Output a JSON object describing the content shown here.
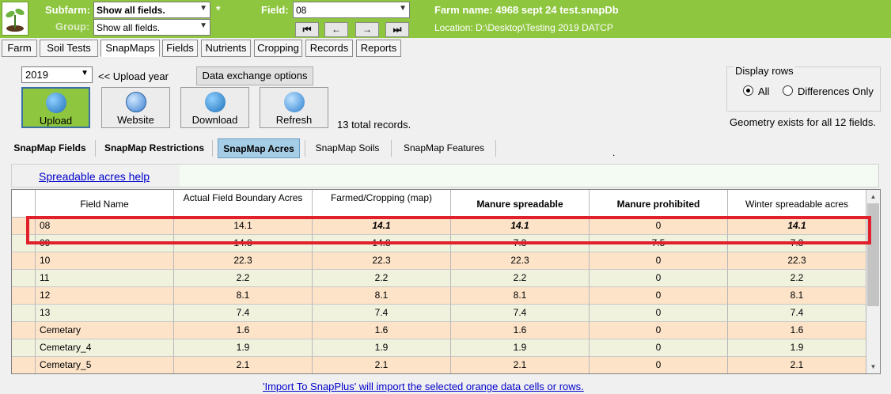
{
  "header": {
    "subfarm_label": "Subfarm:",
    "subfarm_value": "Show all fields.",
    "group_label": "Group:",
    "group_value": "Show all fields.",
    "asterisk": "*",
    "field_label": "Field:",
    "field_value": "08",
    "nav_first": "⏮",
    "nav_prev": "←",
    "nav_next": "→",
    "nav_last": "⏭",
    "farm_name": "Farm name: 4968 sept 24 test.snapDb",
    "location": "Location: D:\\Desktop\\Testing 2019 DATCP"
  },
  "main_tabs": [
    "Farm",
    "Soil Tests",
    "SnapMaps",
    "Fields",
    "Nutrients",
    "Cropping",
    "Records",
    "Reports"
  ],
  "controls": {
    "year": "2019",
    "upload_year_label": "<< Upload year",
    "data_exchange_label": "Data exchange options",
    "upload_label": "Upload",
    "website_label": "Website",
    "download_label": "Download",
    "refresh_label": "Refresh",
    "total_records": "13 total records.",
    "display_rows_label": "Display rows",
    "radio_all": "All",
    "radio_diff": "Differences Only",
    "geometry_msg": "Geometry exists for all 12 fields."
  },
  "sub_tabs": [
    "SnapMap Fields",
    "SnapMap Restrictions",
    "SnapMap Acres",
    "SnapMap Soils",
    "SnapMap Features"
  ],
  "dot": ".",
  "help_link": "Spreadable acres help",
  "table": {
    "headers": [
      "Field Name",
      "Actual Field Boundary Acres",
      "Farmed/Cropping (map)",
      "Manure spreadable",
      "Manure prohibited",
      "Winter spreadable acres"
    ],
    "rows": [
      {
        "name": "08",
        "actual": "14.1",
        "farmed": "14.1",
        "spread": "14.1",
        "prohib": "0",
        "winter": "14.1",
        "style": "orange"
      },
      {
        "name": "09",
        "actual": "14.8",
        "farmed": "14.8",
        "spread": "7.3",
        "prohib": "7.5",
        "winter": "7.3",
        "style": "green"
      },
      {
        "name": "10",
        "actual": "22.3",
        "farmed": "22.3",
        "spread": "22.3",
        "prohib": "0",
        "winter": "22.3",
        "style": "orange"
      },
      {
        "name": "11",
        "actual": "2.2",
        "farmed": "2.2",
        "spread": "2.2",
        "prohib": "0",
        "winter": "2.2",
        "style": "green"
      },
      {
        "name": "12",
        "actual": "8.1",
        "farmed": "8.1",
        "spread": "8.1",
        "prohib": "0",
        "winter": "8.1",
        "style": "orange"
      },
      {
        "name": "13",
        "actual": "7.4",
        "farmed": "7.4",
        "spread": "7.4",
        "prohib": "0",
        "winter": "7.4",
        "style": "green"
      },
      {
        "name": "Cemetary",
        "actual": "1.6",
        "farmed": "1.6",
        "spread": "1.6",
        "prohib": "0",
        "winter": "1.6",
        "style": "orange"
      },
      {
        "name": "Cemetary_4",
        "actual": "1.9",
        "farmed": "1.9",
        "spread": "1.9",
        "prohib": "0",
        "winter": "1.9",
        "style": "green"
      },
      {
        "name": "Cemetary_5",
        "actual": "2.1",
        "farmed": "2.1",
        "spread": "2.1",
        "prohib": "0",
        "winter": "2.1",
        "style": "orange"
      }
    ]
  },
  "footer_link": "'Import To SnapPlus' will import the selected orange data cells or rows.",
  "colors": {
    "top_bar": "#8ec63f",
    "orange_row": "#fde3c8",
    "green_row": "#f1f2de",
    "highlight": "#e0202a",
    "active_subtab": "#a6cde6"
  }
}
